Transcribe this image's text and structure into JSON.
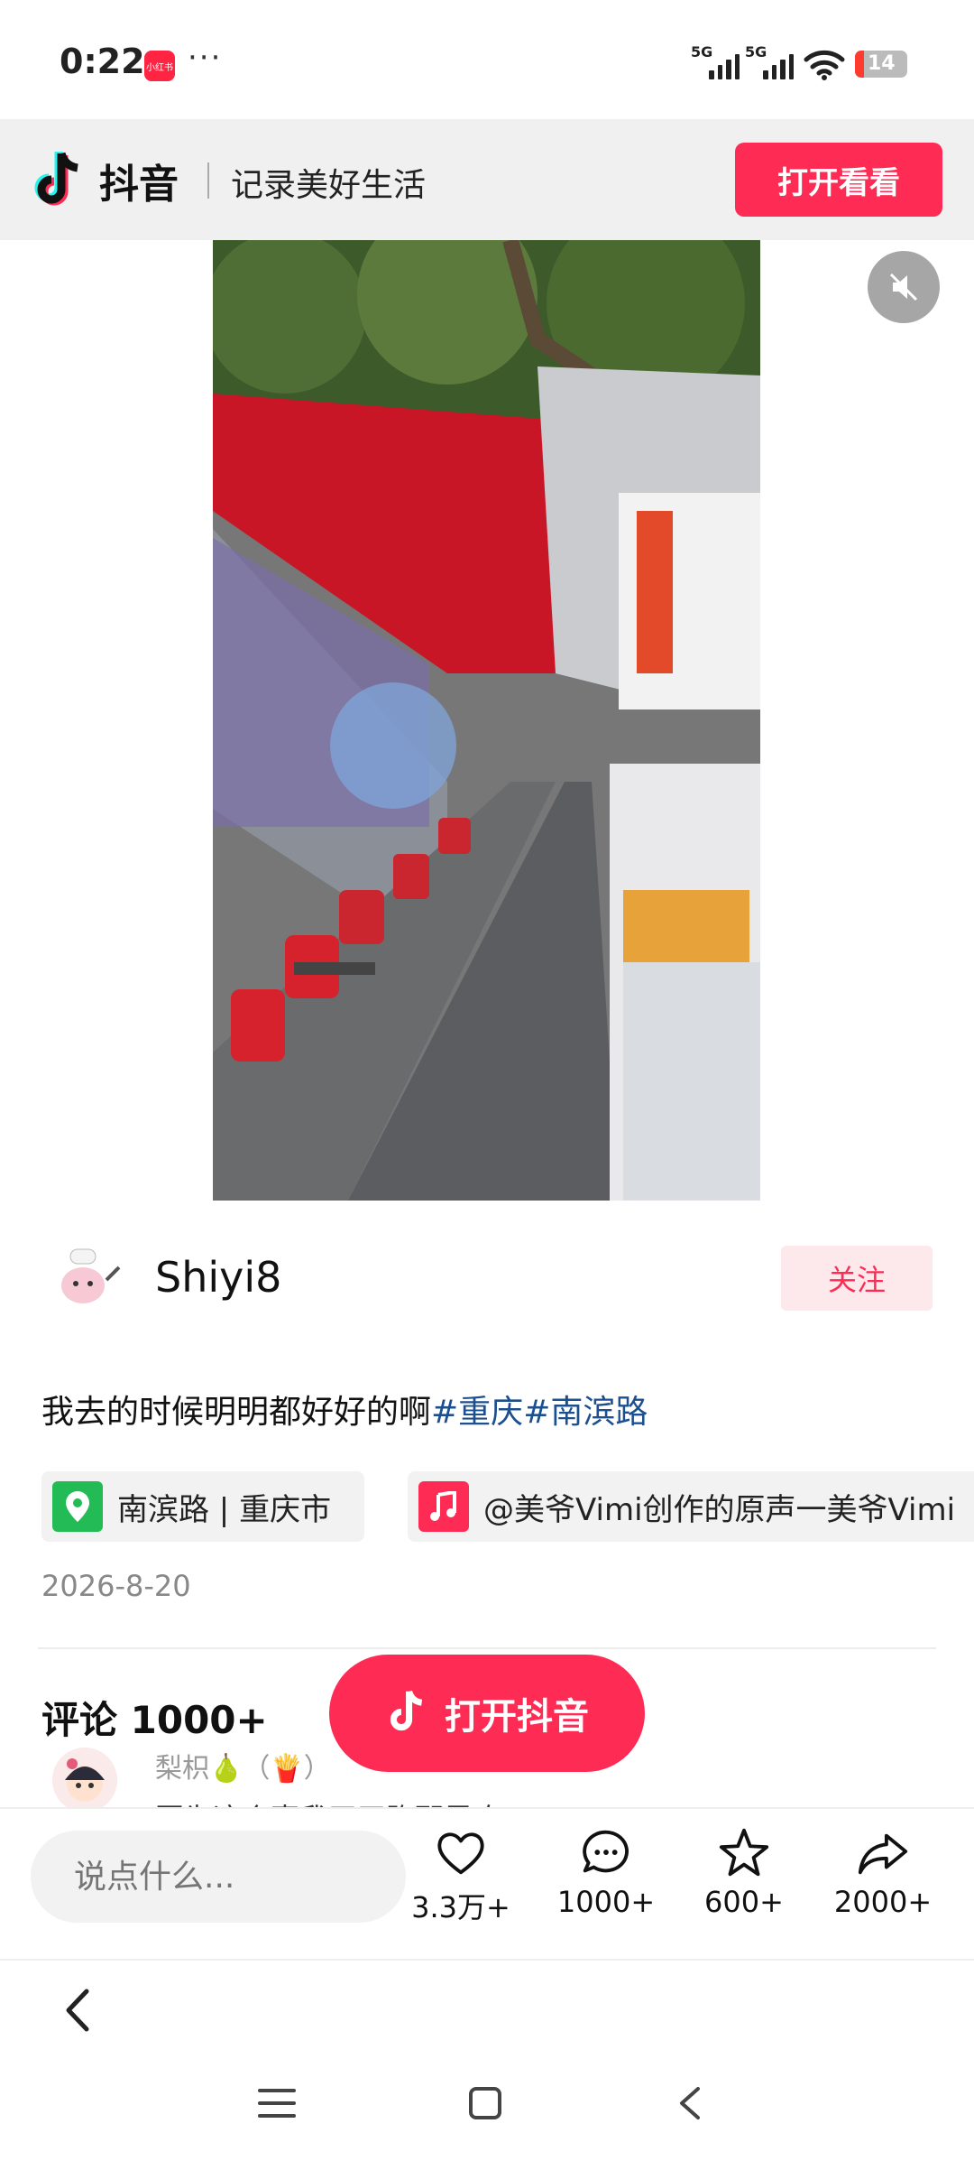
{
  "status_bar": {
    "time": "0:22",
    "app_badge": "小红书",
    "more_dots": "···",
    "signal_1_label": "5G",
    "signal_2_label": "5G",
    "battery_level": "14"
  },
  "banner": {
    "app_name": "抖音",
    "slogan": "记录美好生活",
    "open_button": "打开看看"
  },
  "post": {
    "author": "Shiyi8",
    "follow_label": "关注",
    "description_text": "我去的时候明明都好好的啊",
    "hashtags": [
      "#重庆",
      "#南滨路"
    ],
    "location": "南滨路 | 重庆市",
    "music": "@美爷Vimi创作的原声一美爷Vimi",
    "date": "2026-8-20"
  },
  "comments": {
    "title": "评论 1000+",
    "open_app_button": "打开抖音",
    "first_commenter": "梨枳🍐（🍟）",
    "first_comment": "因为这个事我天天跑那里吃"
  },
  "action_bar": {
    "input_placeholder": "说点什么...",
    "likes": "3.3万+",
    "comments": "1000+",
    "favorites": "600+",
    "shares": "2000+"
  },
  "colors": {
    "accent": "#fe2c55",
    "hashtag": "#1b4f8f",
    "location_icon": "#22bb55"
  }
}
